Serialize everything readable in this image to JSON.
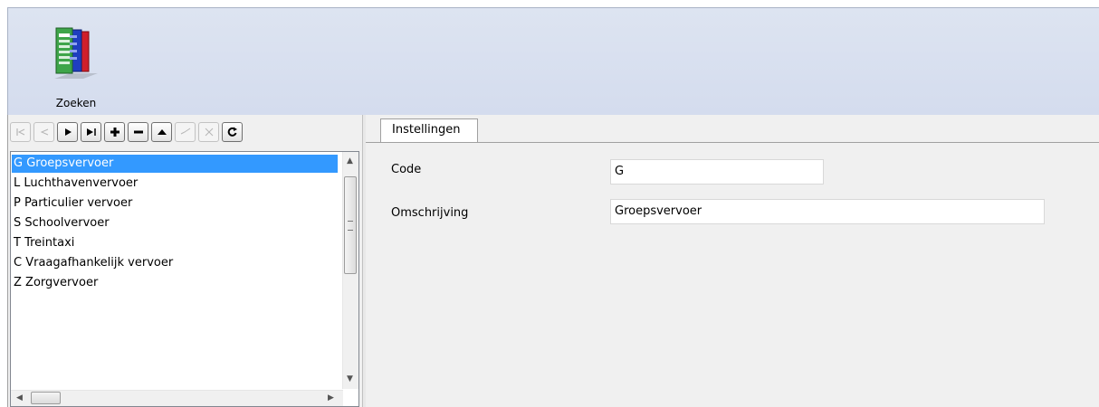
{
  "ribbon": {
    "search_button": {
      "label": "Zoeken",
      "icon": "report-books-icon"
    }
  },
  "navigator": {
    "buttons": [
      {
        "name": "first-record-button",
        "glyph": "|◁",
        "enabled": false
      },
      {
        "name": "prior-record-button",
        "glyph": "◁",
        "enabled": false
      },
      {
        "name": "next-record-button",
        "glyph": "▶",
        "enabled": true
      },
      {
        "name": "last-record-button",
        "glyph": "▶|",
        "enabled": true
      },
      {
        "name": "insert-record-button",
        "glyph": "+",
        "enabled": true
      },
      {
        "name": "delete-record-button",
        "glyph": "−",
        "enabled": true
      },
      {
        "name": "edit-record-button",
        "glyph": "▲",
        "enabled": true
      },
      {
        "name": "post-record-button",
        "glyph": "✓",
        "enabled": false
      },
      {
        "name": "cancel-record-button",
        "glyph": "✕",
        "enabled": false
      },
      {
        "name": "refresh-button",
        "glyph": "↻",
        "enabled": true
      }
    ]
  },
  "list": {
    "items": [
      "G Groepsvervoer",
      "L Luchthavenvervoer",
      "P Particulier vervoer",
      "S Schoolvervoer",
      "T Treintaxi",
      "C Vraagafhankelijk vervoer",
      "Z Zorgvervoer"
    ],
    "selected_index": 0
  },
  "tabs": [
    {
      "label": "Instellingen",
      "active": true
    }
  ],
  "form": {
    "code_label": "Code",
    "code_value": "G",
    "description_label": "Omschrijving",
    "description_value": "Groepsvervoer"
  }
}
